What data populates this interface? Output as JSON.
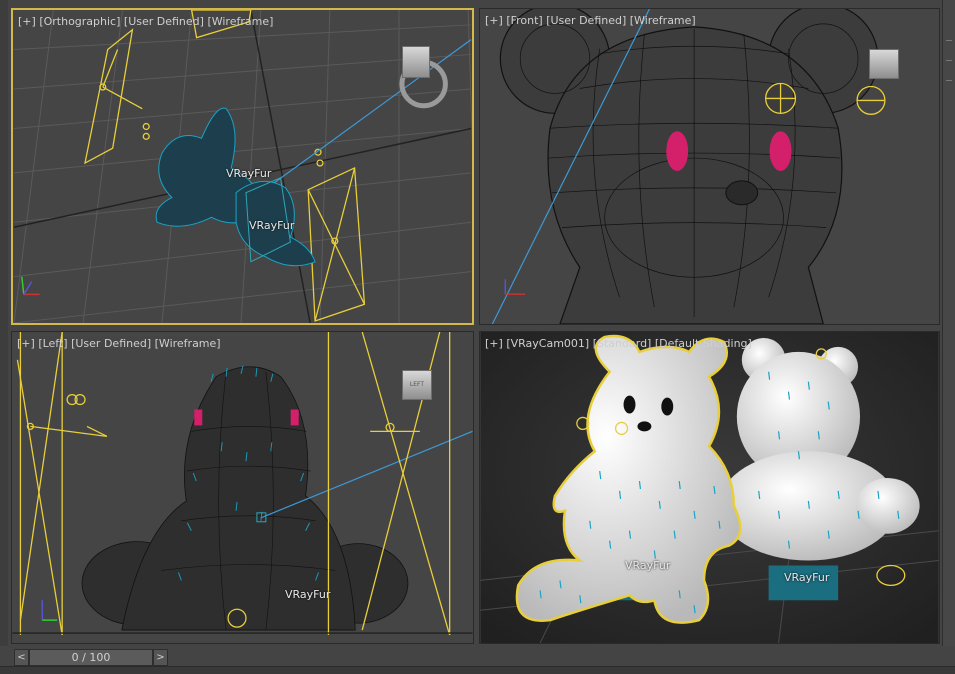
{
  "viewports": {
    "top_left": {
      "plus": "[+]",
      "view": "[Orthographic]",
      "mode": "[User Defined]",
      "shading": "[Wireframe]",
      "tags": [
        "VRayFur",
        "VRayFur"
      ]
    },
    "top_right": {
      "plus": "[+]",
      "view": "[Front]",
      "mode": "[User Defined]",
      "shading": "[Wireframe]"
    },
    "bottom_left": {
      "plus": "[+]",
      "view": "[Left]",
      "mode": "[User Defined]",
      "shading": "[Wireframe]",
      "cube_label": "LEFT",
      "tags": [
        "VRayFur"
      ]
    },
    "bottom_right": {
      "plus": "[+]",
      "view": "[VRayCam001]",
      "mode": "[Standard]",
      "shading": "[Default Shading]",
      "tags": [
        "VRayFur",
        "VRayFur"
      ]
    }
  },
  "timeline": {
    "prev": "<",
    "next": ">",
    "frame": "0 / 100"
  },
  "colors": {
    "selection": "#e8cf3a",
    "fur": "#1aa3c4",
    "accent": "#d4b94a",
    "eye": "#d4206a"
  }
}
